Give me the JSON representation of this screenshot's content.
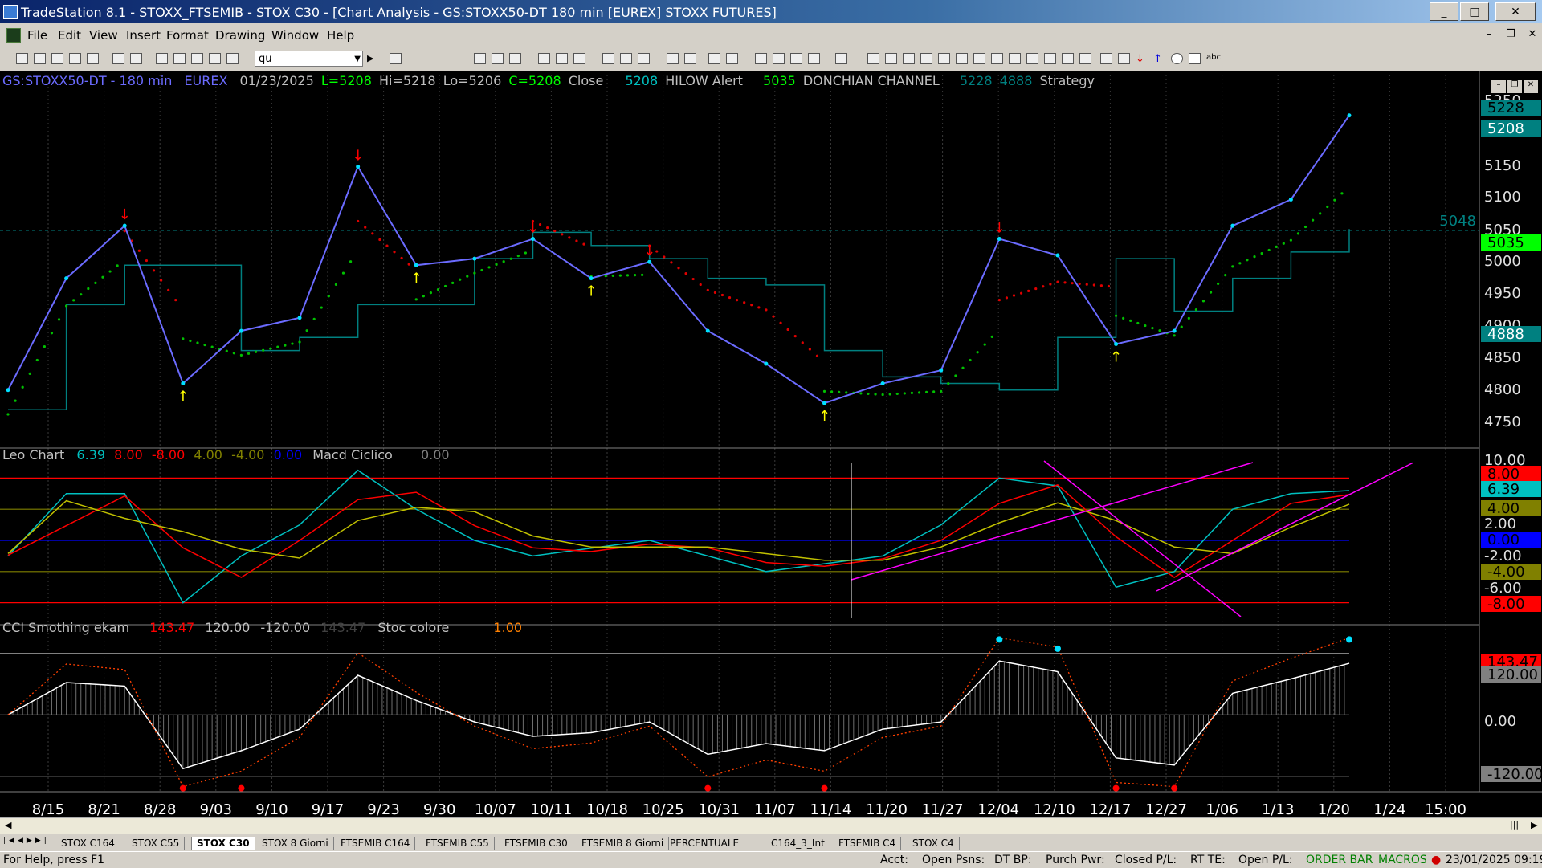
{
  "window": {
    "title": "TradeStation 8.1 - STOXX_FTSEMIB - STOX  C30 - [Chart Analysis - GS:STOXX50-DT  180 min  [EUREX] STOXX FUTURES]"
  },
  "menu": {
    "icon": "tradestation-app-icon",
    "items": [
      "File",
      "Edit",
      "View",
      "Insert",
      "Format",
      "Drawing",
      "Window",
      "Help"
    ]
  },
  "toolbar": {
    "symbol_input": "qu"
  },
  "chart_header": {
    "symbol": "GS:STOXX50-DT - 180 min",
    "exchange": "EUREX",
    "date": "01/23/2025",
    "last": "L=5208",
    "high": "Hi=5218",
    "low": "Lo=5206",
    "close_val": "C=5208",
    "close_label": "Close",
    "hilow_val": "5208",
    "hilow_label": "HILOW Alert",
    "donchian_val": "5035",
    "donchian_label": "DONCHIAN CHANNEL",
    "strategy_hi": "5228",
    "strategy_lo": "4888",
    "strategy_label": "Strategy"
  },
  "macd_header": {
    "name": "Leo Chart",
    "v1": "6.39",
    "v2": "8.00",
    "v3": "-8.00",
    "v4": "4.00",
    "v5": "-4.00",
    "v6": "0.00",
    "name2": "Macd Ciclico",
    "v7": "0.00"
  },
  "cci_header": {
    "name": "CCI Smothing ekam",
    "v1": "143.47",
    "v2": "120.00",
    "v3": "-120.00",
    "v4": "143.47",
    "name2": "Stoc colore",
    "v5": "1.00"
  },
  "price_axis": {
    "ticks": [
      "5250",
      "5150",
      "5100",
      "5050",
      "5000",
      "4950",
      "4900",
      "4850",
      "4800",
      "4750"
    ],
    "badges": [
      {
        "text": "5228",
        "bg": "#008080",
        "fg": "#000000"
      },
      {
        "text": "5208",
        "bg": "#008080",
        "fg": "#ffffff"
      },
      {
        "text": "5035",
        "bg": "#00ff00",
        "fg": "#000000"
      },
      {
        "text": "4888",
        "bg": "#008080",
        "fg": "#ffffff"
      }
    ],
    "ref_label": "5048"
  },
  "macd_axis": {
    "ticks": [
      "10.00",
      "2.00",
      "-2.00",
      "-6.00"
    ],
    "badges": [
      {
        "text": "8.00",
        "bg": "#ff0000",
        "fg": "#000000"
      },
      {
        "text": "6.39",
        "bg": "#00c0c0",
        "fg": "#000000"
      },
      {
        "text": "4.00",
        "bg": "#808000",
        "fg": "#000000"
      },
      {
        "text": "0.00",
        "bg": "#0000ff",
        "fg": "#000000"
      },
      {
        "text": "-4.00",
        "bg": "#808000",
        "fg": "#000000"
      },
      {
        "text": "-8.00",
        "bg": "#ff0000",
        "fg": "#000000"
      }
    ]
  },
  "cci_axis": {
    "ticks": [
      "0.00"
    ],
    "badges": [
      {
        "text": "143.47",
        "bg": "#ff0000",
        "fg": "#000000"
      },
      {
        "text": "120.00",
        "bg": "#808080",
        "fg": "#000000"
      },
      {
        "text": "-120.00",
        "bg": "#808080",
        "fg": "#000000"
      }
    ]
  },
  "time_axis": [
    "8/15",
    "8/21",
    "8/28",
    "9/03",
    "9/10",
    "9/17",
    "9/23",
    "9/30",
    "10/07",
    "10/11",
    "10/18",
    "10/25",
    "10/31",
    "11/07",
    "11/14",
    "11/20",
    "11/27",
    "12/04",
    "12/10",
    "12/17",
    "12/27",
    "1/06",
    "1/13",
    "1/20",
    "1/24",
    "15:00"
  ],
  "tabs": [
    "STOX C164",
    "STOX C55",
    "STOX  C30",
    "STOX  8 Giorni",
    "FTSEMIB C164",
    "FTSEMIB C55",
    "FTSEMIB C30",
    "FTSEMIB  8 Giorni",
    "PERCENTUALE",
    "C164_3_Int",
    "FTSEMIB C4",
    "STOX  C4"
  ],
  "active_tab": "STOX  C30",
  "status": {
    "help": "For Help, press F1",
    "acct": "Acct:",
    "open_psns": "Open Psns:",
    "dt_bp": "DT BP:",
    "purch_pwr": "Purch Pwr:",
    "closed_pl": "Closed P/L:",
    "rt_te": "RT TE:",
    "open_pl": "Open P/L:",
    "order_bar": "ORDER BAR",
    "macros": "MACROS",
    "datetime": "23/01/2025 09:19"
  },
  "colors": {
    "price": "#6b6bff",
    "donchian": "#008080",
    "up_dots": "#00c000",
    "down_dots": "#e00000",
    "up_arrow": "#ffff00",
    "down_arrow": "#ff0000",
    "macd_fast": "#00c0c0",
    "macd_slow": "#ff0000",
    "macd_signal": "#c0c000",
    "trendline": "#ff00ff",
    "cci_dotted": "#ff4000"
  },
  "chart_data": [
    {
      "type": "line",
      "title": "GS:STOXX50-DT - 180 min",
      "x": [
        "8/15",
        "8/21",
        "8/28",
        "9/03",
        "9/10",
        "9/17",
        "9/23",
        "9/30",
        "10/07",
        "10/11",
        "10/18",
        "10/25",
        "10/31",
        "11/07",
        "11/14",
        "11/20",
        "11/27",
        "12/04",
        "12/10",
        "12/17",
        "12/27",
        "1/06",
        "1/13",
        "1/20"
      ],
      "series": [
        {
          "name": "Close",
          "values": [
            4790,
            4960,
            5040,
            4800,
            4880,
            4900,
            5130,
            4980,
            4990,
            5020,
            4960,
            4985,
            4880,
            4830,
            4770,
            4800,
            4820,
            5020,
            4995,
            4860,
            4880,
            5040,
            5080,
            5208
          ]
        },
        {
          "name": "HILOW Alert",
          "values": [
            4790,
            4960,
            5040,
            4800,
            4880,
            4900,
            5130,
            4980,
            4990,
            5020,
            4960,
            4985,
            4880,
            4830,
            4770,
            4800,
            4820,
            5020,
            4995,
            4860,
            4880,
            5040,
            5080,
            5208
          ]
        },
        {
          "name": "DONCHIAN CHANNEL",
          "values": [
            4760,
            4920,
            4980,
            4980,
            4850,
            4870,
            4920,
            4920,
            4990,
            5030,
            5010,
            4990,
            4960,
            4950,
            4850,
            4810,
            4800,
            4790,
            4870,
            4990,
            4910,
            4960,
            5000,
            5035
          ]
        }
      ],
      "ylim": [
        4720,
        5270
      ]
    },
    {
      "type": "line",
      "title": "Macd Ciclico",
      "x": [
        "8/15",
        "8/21",
        "8/28",
        "9/03",
        "9/10",
        "9/17",
        "9/23",
        "9/30",
        "10/07",
        "10/11",
        "10/18",
        "10/25",
        "10/31",
        "11/07",
        "11/14",
        "11/20",
        "11/27",
        "12/04",
        "12/10",
        "12/17",
        "12/27",
        "1/06",
        "1/13",
        "1/20"
      ],
      "series": [
        {
          "name": "Leo Chart",
          "values": [
            -2,
            6,
            6,
            -8,
            -2,
            2,
            9,
            4,
            0,
            -2,
            -1,
            0,
            -2,
            -4,
            -3,
            -2,
            2,
            8,
            7,
            -6,
            -4,
            4,
            6,
            6.39
          ]
        }
      ],
      "ylim": [
        -10,
        10
      ]
    },
    {
      "type": "line",
      "title": "CCI Smothing ekam",
      "x": [
        "8/15",
        "8/21",
        "8/28",
        "9/03",
        "9/10",
        "9/17",
        "9/23",
        "9/30",
        "10/07",
        "10/11",
        "10/18",
        "10/25",
        "10/31",
        "11/07",
        "11/14",
        "11/20",
        "11/27",
        "12/04",
        "12/10",
        "12/17",
        "12/27",
        "1/06",
        "1/13",
        "1/20"
      ],
      "series": [
        {
          "name": "CCI Smothing ekam",
          "values": [
            0,
            90,
            80,
            -150,
            -100,
            -40,
            110,
            40,
            -20,
            -60,
            -50,
            -20,
            -110,
            -80,
            -100,
            -40,
            -20,
            150,
            120,
            -120,
            -140,
            60,
            100,
            143.47
          ]
        }
      ],
      "ylim": [
        -150,
        160
      ]
    }
  ]
}
